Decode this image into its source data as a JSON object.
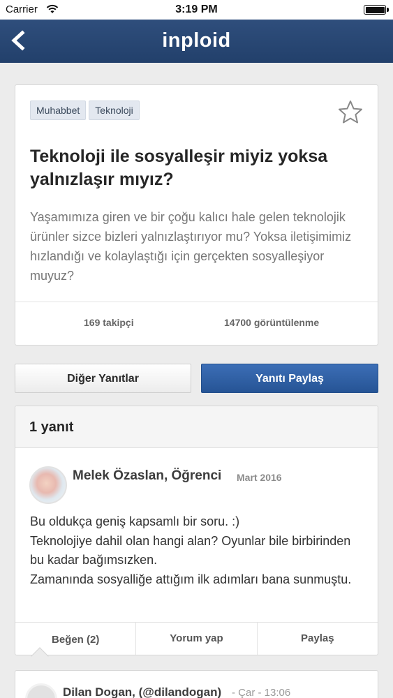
{
  "status_bar": {
    "carrier": "Carrier",
    "time": "3:19 PM"
  },
  "nav": {
    "title": "inploid"
  },
  "question": {
    "tags": [
      "Muhabbet",
      "Teknoloji"
    ],
    "title": "Teknoloji ile sosyalleşir miyiz yoksa yalnızlaşır mıyız?",
    "description": "Yaşamımıza giren ve bir çoğu kalıcı hale gelen teknolojik ürünler sizce bizleri yalnızlaştırıyor mu? Yoksa iletişimimiz hızlandığı ve kolaylaştığı için gerçekten sosyalleşiyor muyuz?",
    "followers": "169 takipçi",
    "views": "14700 görüntülenme"
  },
  "buttons": {
    "other_answers": "Diğer Yanıtlar",
    "share_answer": "Yanıtı Paylaş"
  },
  "answer": {
    "count_label": "1 yanıt",
    "author": "Melek Özaslan, Öğrenci",
    "date": "Mart 2016",
    "body": "Bu oldukça geniş kapsamlı bir soru. :)\nTeknolojiye dahil olan hangi alan? Oyunlar bile birbirinden bu kadar bağımsızken.\nZamanında sosyalliğe attığım ilk adımları bana sunmuştu.",
    "actions": {
      "like": "Beğen (2)",
      "comment": "Yorum yap",
      "share": "Paylaş"
    }
  },
  "comment": {
    "author": "Dilan Dogan, (@dilandogan)",
    "date": "- Çar - 13:06"
  },
  "colors": {
    "nav": "#2a4874",
    "primary_button": "#2f5fa6",
    "tag_bg": "#e3e8f0"
  }
}
